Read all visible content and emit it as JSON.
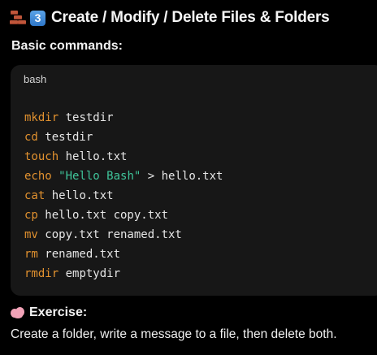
{
  "section": {
    "icons": [
      "bricks-icon",
      "keycap-3-icon"
    ],
    "keycap_digit": "3",
    "title": "Create / Modify / Delete Files & Folders"
  },
  "subheading": "Basic commands:",
  "code_block": {
    "language": "bash",
    "lines": [
      {
        "cmd": "mkdir",
        "args": " testdir"
      },
      {
        "cmd": "cd",
        "args": " testdir"
      },
      {
        "cmd": "touch",
        "args": " hello.txt"
      },
      {
        "cmd": "echo",
        "pre": " ",
        "str": "\"Hello Bash\"",
        "args": " > hello.txt"
      },
      {
        "cmd": "cat",
        "args": " hello.txt"
      },
      {
        "cmd": "cp",
        "args": " hello.txt copy.txt"
      },
      {
        "cmd": "mv",
        "args": " copy.txt renamed.txt"
      },
      {
        "cmd": "rm",
        "args": " renamed.txt"
      },
      {
        "cmd": "rmdir",
        "args": " emptydir"
      }
    ]
  },
  "exercise": {
    "icon": "brain-icon",
    "title": "Exercise:",
    "text": "Create a folder, write a message to a file, then delete both."
  },
  "colors": {
    "background": "#000000",
    "code_background": "#171717",
    "command": "#e1912f",
    "string": "#3fc59a",
    "text": "#f2f2f2"
  }
}
